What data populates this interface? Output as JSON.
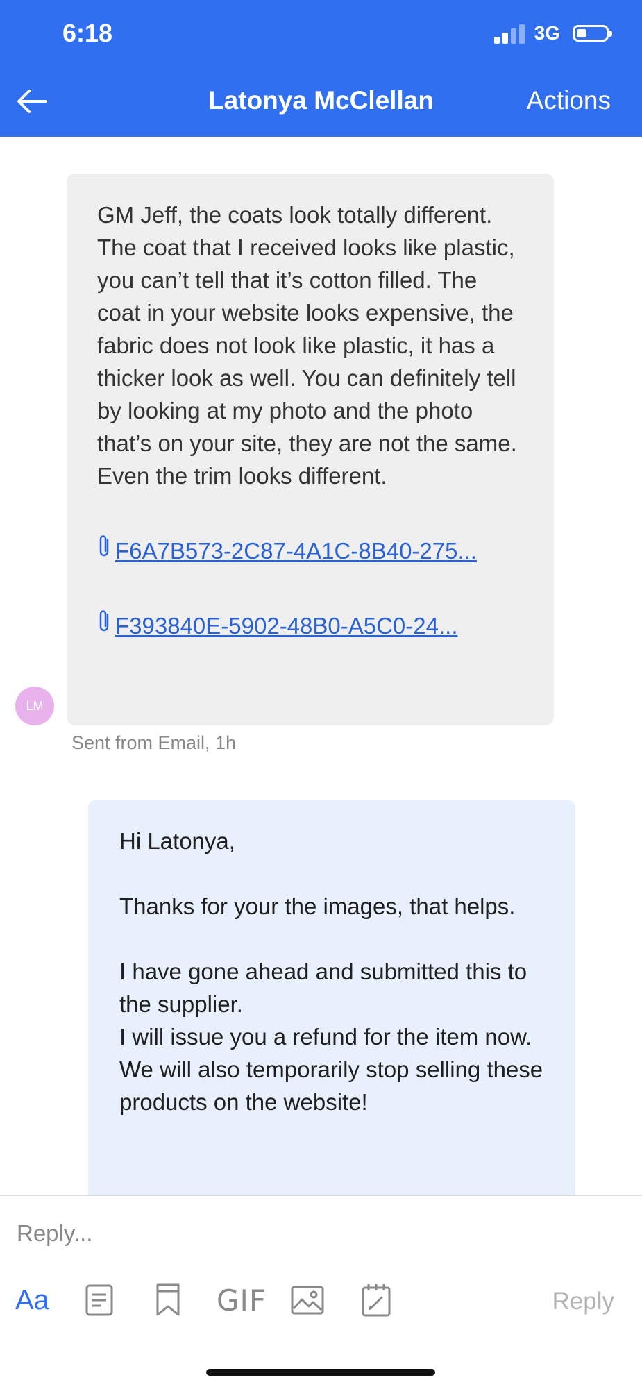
{
  "status_bar": {
    "time": "6:18",
    "network": "3G"
  },
  "header": {
    "title": "Latonya McClellan",
    "actions_label": "Actions"
  },
  "incoming_message": {
    "text": "GM Jeff, the coats look totally different. The coat that I received looks like plastic, you can’t tell that it’s cotton filled. The coat in your website looks expensive, the fabric does not look like plastic, it has a thicker look as well. You can definitely tell by looking at my photo and the photo that’s on your site, they are not the same. Even the trim looks different.",
    "attachments": [
      "F6A7B573-2C87-4A1C-8B40-275...",
      "F393840E-5902-48B0-A5C0-24..."
    ],
    "avatar_initials": "LM",
    "meta": "Sent from Email, 1h"
  },
  "outgoing_message": {
    "greeting": "Hi Latonya,",
    "para1": "Thanks for your the images, that helps.",
    "para2_line1": "I have gone ahead and submitted this to the supplier.",
    "para2_line2": "I will issue you a refund for the item now. We will also temporarily stop selling these products on the website!"
  },
  "composer": {
    "placeholder": "Reply...",
    "format_label": "Aa",
    "gif_label": "GIF",
    "send_label": "Reply"
  },
  "colors": {
    "accent": "#2f6ff0",
    "incoming_bg": "#efefef",
    "outgoing_bg": "#e8effd",
    "avatar_bg": "#e8b2ec",
    "link": "#2a62d6"
  }
}
